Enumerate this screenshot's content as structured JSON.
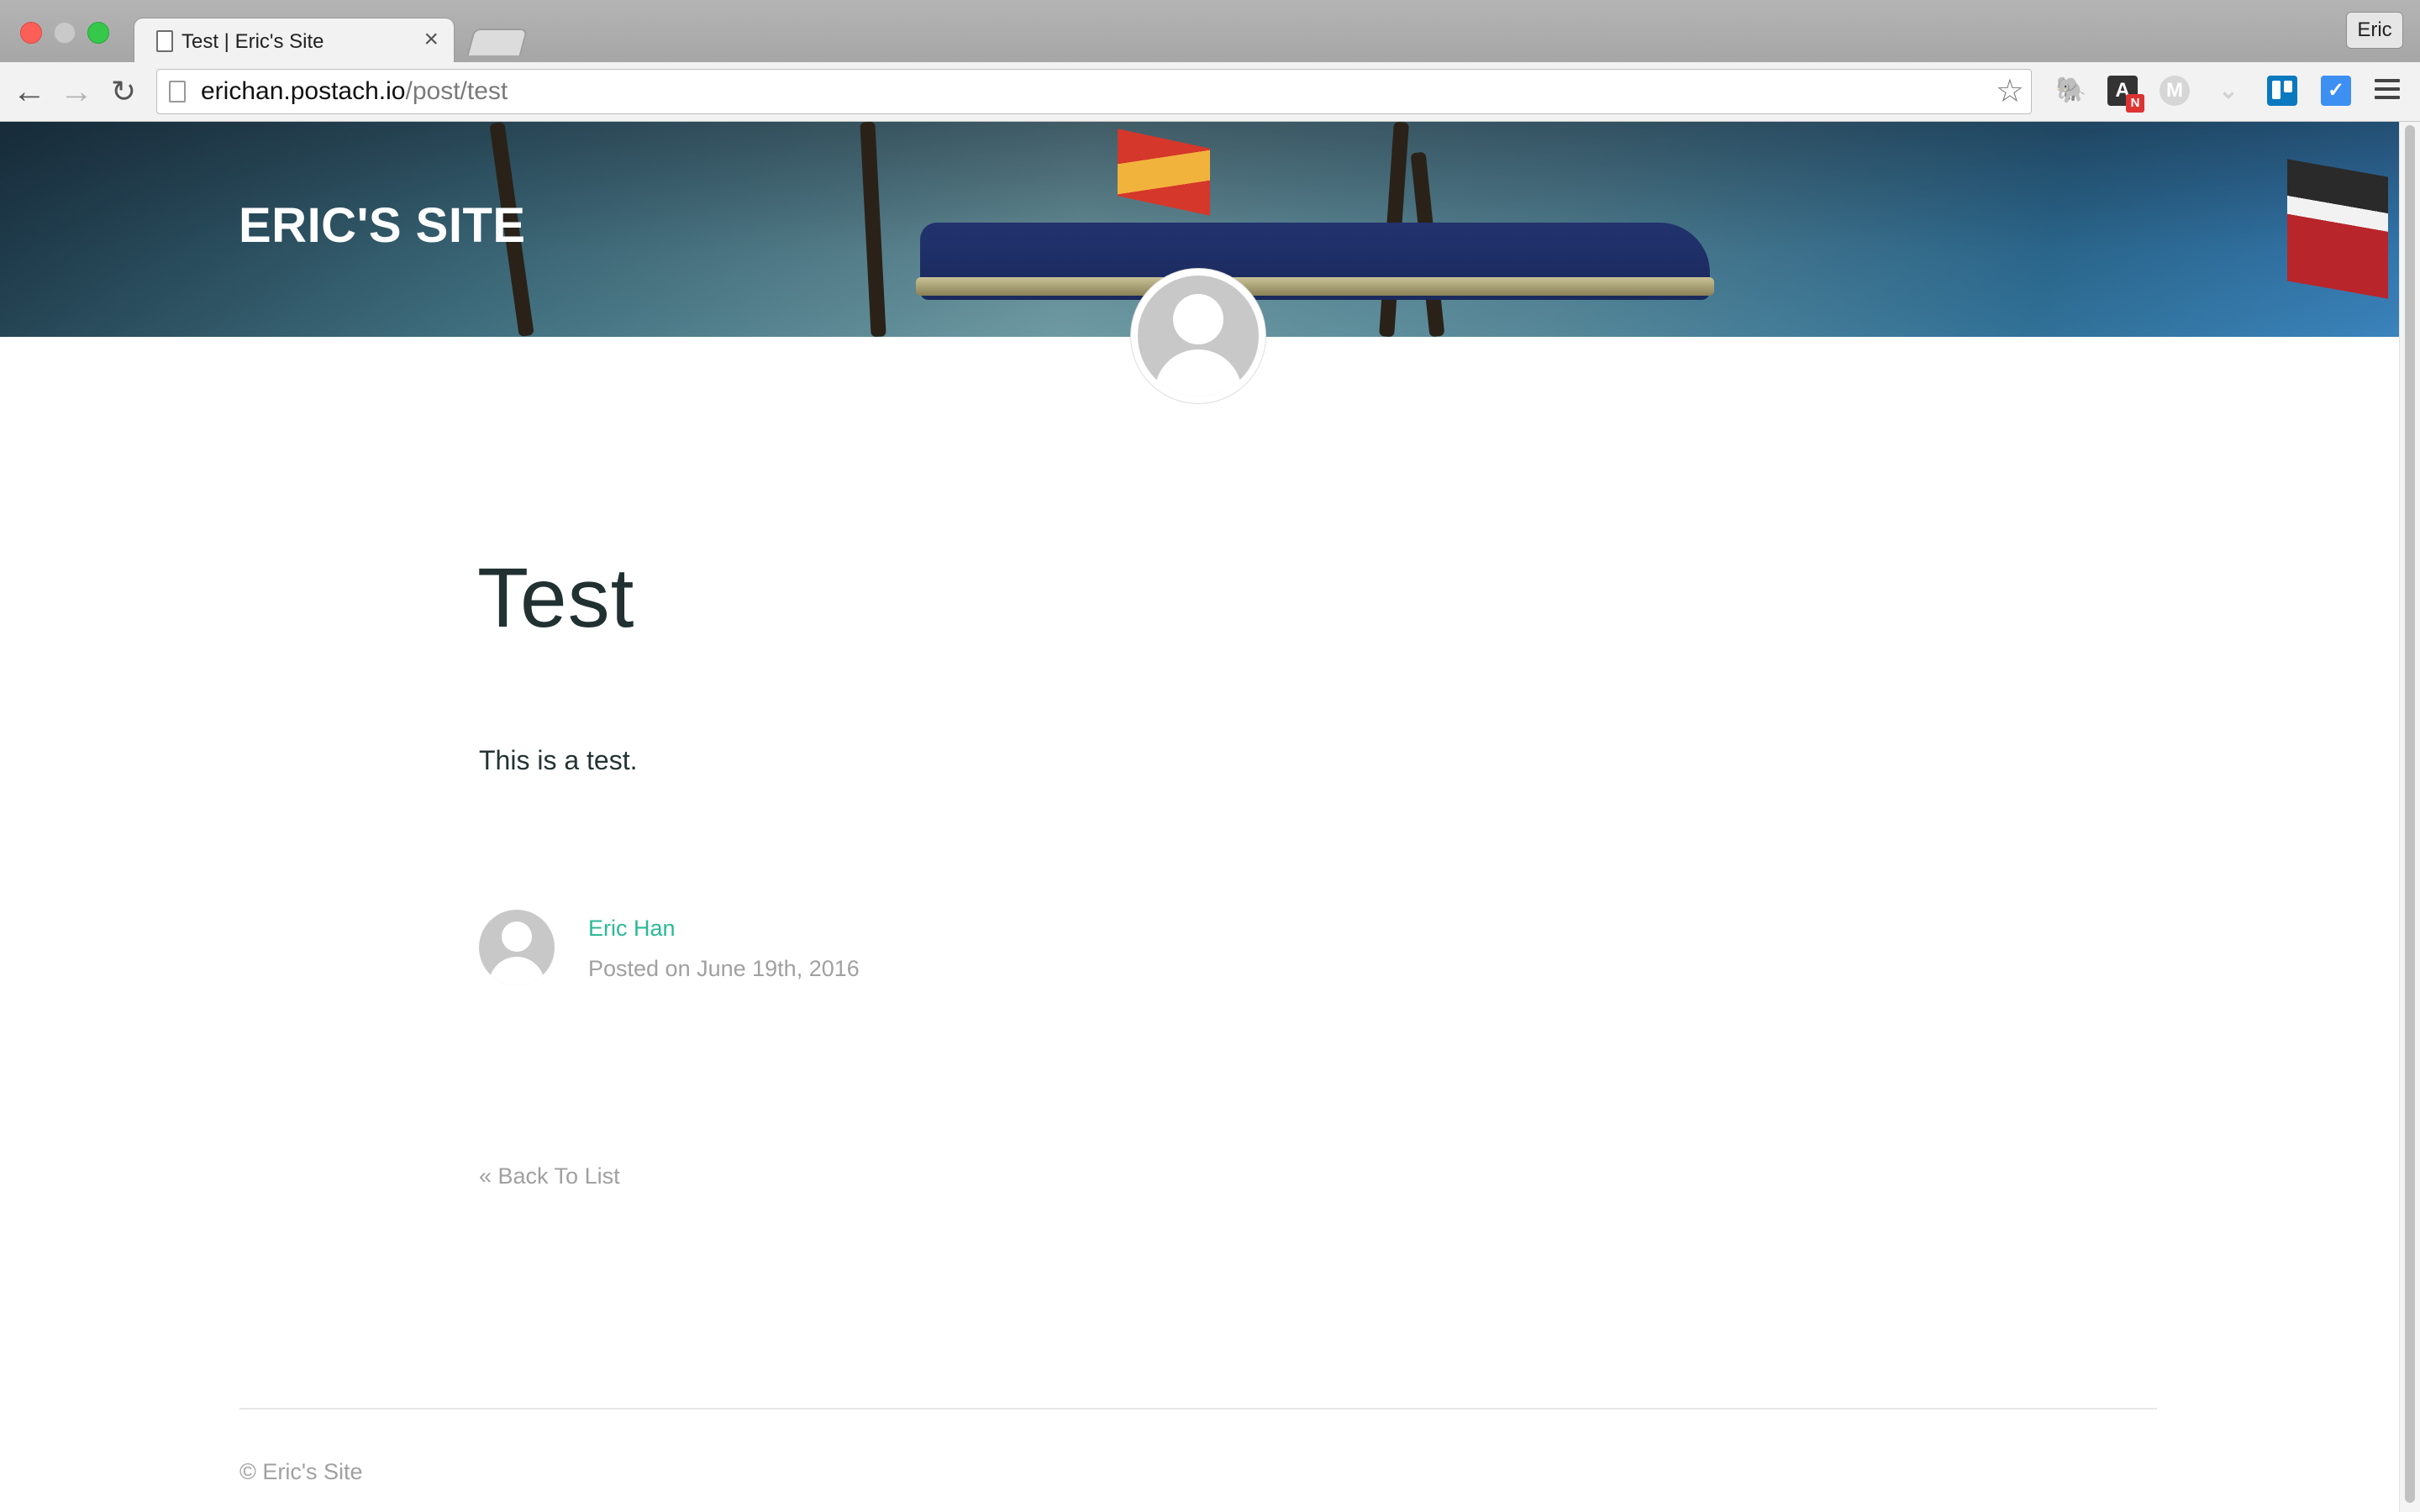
{
  "browser": {
    "tab_title": "Test | Eric's Site",
    "tab_close": "×",
    "profile_name": "Eric",
    "url_host": "erichan.postach.io",
    "url_path": "/post/test",
    "icons": {
      "back": "arrow-left",
      "forward": "arrow-right",
      "reload": "reload",
      "bookmark": "star",
      "menu": "hamburger"
    },
    "extensions": [
      {
        "name": "evernote",
        "glyph": "🐘"
      },
      {
        "name": "adn",
        "glyph": "A",
        "badge": "N"
      },
      {
        "name": "medium",
        "glyph": "M"
      },
      {
        "name": "pocket",
        "glyph": "⌄"
      },
      {
        "name": "trello",
        "glyph": ""
      },
      {
        "name": "chart",
        "glyph": "✓"
      }
    ]
  },
  "page": {
    "site_title": "ERIC'S SITE",
    "post_title": "Test",
    "post_body": "This is a test.",
    "author_name": "Eric Han",
    "post_date": "Posted on June 19th, 2016",
    "back_link": "« Back To List",
    "copyright": "© Eric's Site"
  },
  "colors": {
    "accent": "#2bb996",
    "muted_text": "#a0a0a0",
    "title_text": "#213131"
  }
}
